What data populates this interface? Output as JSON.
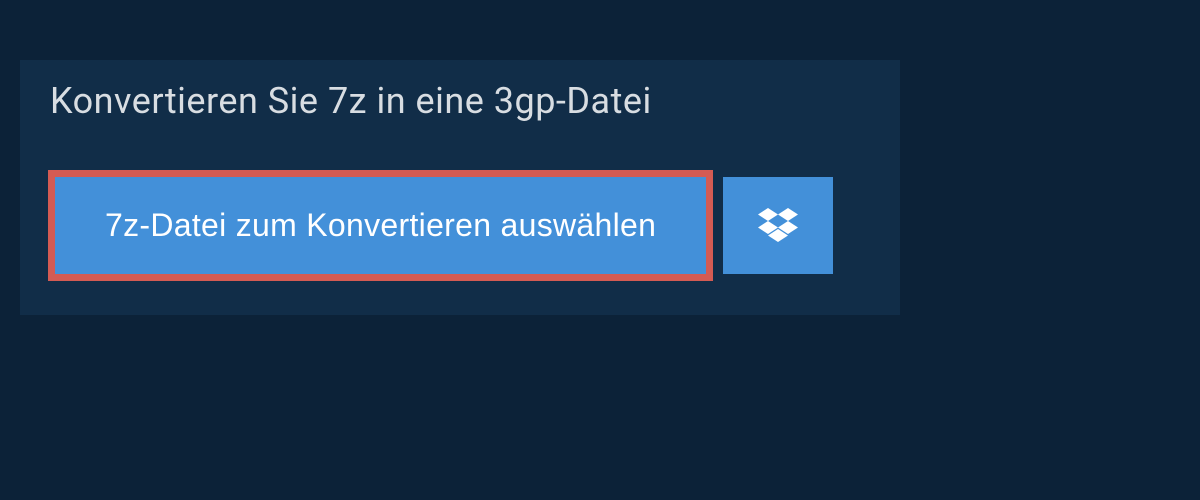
{
  "title": "Konvertieren Sie 7z in eine 3gp-Datei",
  "select_button_label": "7z-Datei zum Konvertieren auswählen",
  "colors": {
    "background": "#0c2238",
    "panel": "#112d48",
    "button": "#4390d9",
    "highlight_border": "#d45b53",
    "title_text": "#d8dde2"
  }
}
